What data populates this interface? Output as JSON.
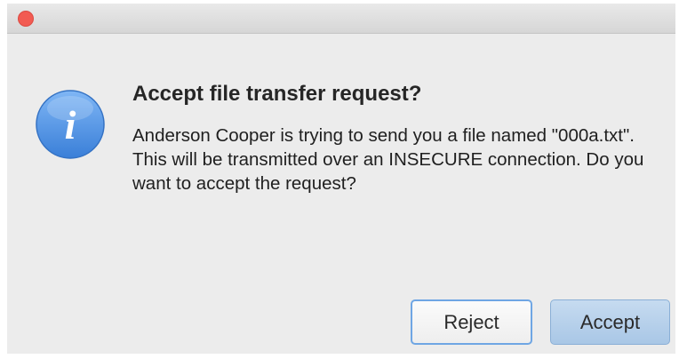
{
  "dialog": {
    "title": "Accept file transfer request?",
    "message": "Anderson Cooper is trying to send you a file named \"000a.txt\". This will be transmitted over an INSECURE connection. Do you want to accept the request?",
    "icon": "info-icon",
    "icon_glyph": "i",
    "accent_color": "#4f8fe0"
  },
  "buttons": {
    "reject_label": "Reject",
    "accept_label": "Accept"
  },
  "titlebar": {
    "close_color": "#f25b52"
  }
}
